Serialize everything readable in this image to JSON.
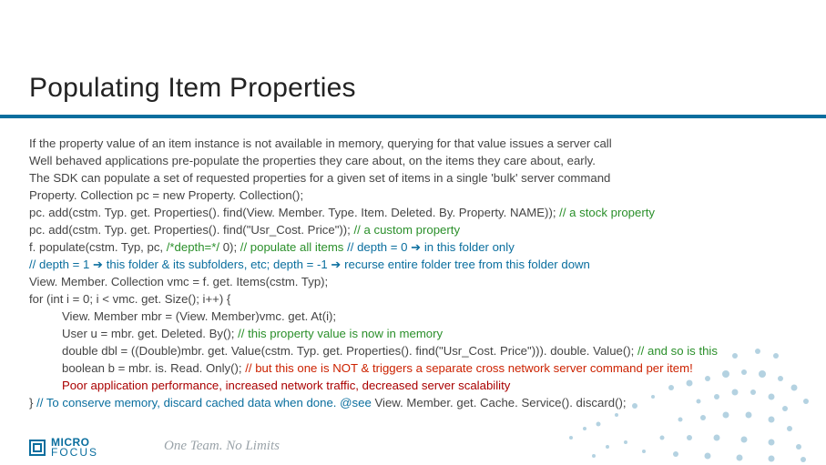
{
  "title": "Populating Item Properties",
  "lines": {
    "l1": "If the property value of an item instance is not available in memory, querying for that value issues a server call",
    "l2": "Well behaved applications pre-populate the properties they care about, on the items they care about, early.",
    "l3": "The SDK can populate a set of requested properties for a given set of items in a single 'bulk' server command",
    "l4a": "Property. Collection pc = new Property. Collection();",
    "l5a": "pc. add(cstm. Typ. get. Properties(). find(View. Member. Type. Item. Deleted. By. Property. NAME)); ",
    "l5b": "// a stock property",
    "l6a": "pc. add(cstm. Typ. get. Properties(). find(\"Usr_Cost. Price\")); ",
    "l6b": "// a custom property",
    "l7a": "f. populate(cstm. Typ, pc, ",
    "l7b": "/*depth=*/ ",
    "l7c": "0); ",
    "l7d": "// populate all items ",
    "l7e": "// depth = 0 ",
    "l7f": " in this folder only",
    "l8a": "// depth = 1 ",
    "l8b": " this folder & its subfolders, etc; depth = -1 ",
    "l8c": " recurse entire folder tree from this folder down",
    "l9": "View. Member. Collection vmc = f. get. Items(cstm. Typ);",
    "l10": "for (int i = 0; i < vmc. get. Size(); i++) {",
    "l11": "View. Member mbr = (View. Member)vmc. get. At(i);",
    "l12a": "User u = mbr. get. Deleted. By(); ",
    "l12b": "// this property value is now in memory",
    "l13a": "double dbl = ((Double)mbr. get. Value(cstm. Typ. get. Properties(). find(\"Usr_Cost. Price\"))). double. Value(); ",
    "l13b": "// and so is this",
    "l14a": "boolean b = mbr. is. Read. Only();     ",
    "l14b": "// but this one is NOT & triggers a separate cross network server command per item!",
    "l15": "Poor application performance, increased network traffic, decreased server scalability",
    "l16a": "} ",
    "l16b": "// To conserve memory, discard cached data when done.  ",
    "l16c": "@see ",
    "l16d": "View. Member. get. Cache. Service(). discard();"
  },
  "brand": {
    "top": "MICRO",
    "bottom": "FOCUS"
  },
  "tagline": "One Team. No Limits",
  "arrow": "➔"
}
